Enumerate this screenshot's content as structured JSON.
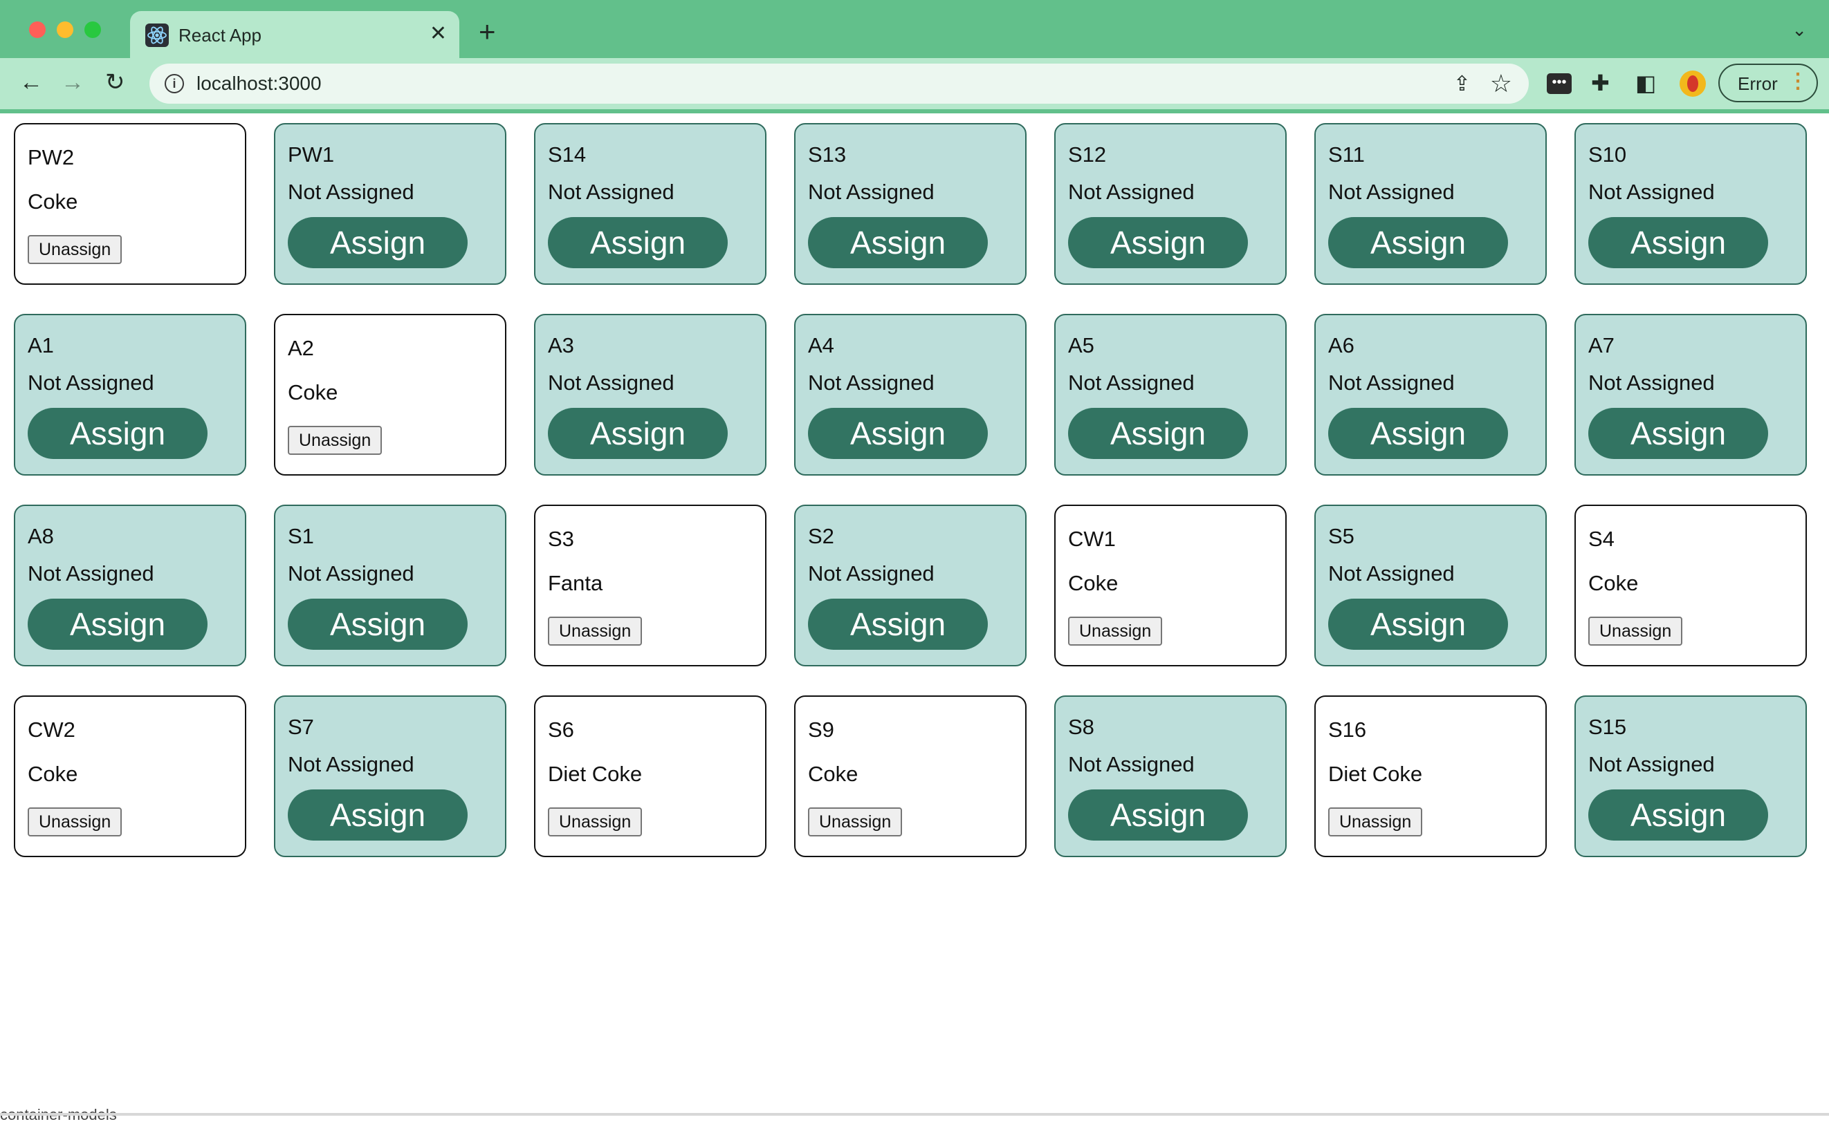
{
  "browser": {
    "tab_title": "React App",
    "url": "localhost:3000",
    "error_label": "Error",
    "icons": [
      "react-logo-icon",
      "close-icon",
      "plus-icon",
      "chevron-down-icon",
      "back-arrow-icon",
      "forward-arrow-icon",
      "reload-icon",
      "info-icon",
      "share-icon",
      "star-icon",
      "extension-icon",
      "puzzle-icon",
      "sidebar-icon",
      "profile-icon",
      "menu-dots-icon"
    ]
  },
  "labels": {
    "not_assigned": "Not Assigned",
    "assign": "Assign",
    "unassign": "Unassign"
  },
  "colors": {
    "chrome": "#62c08b",
    "card_unassigned_bg": "#bddfdb",
    "assign_button": "#327462"
  },
  "cards": [
    {
      "name": "PW2",
      "drink": "Coke"
    },
    {
      "name": "PW1",
      "drink": null
    },
    {
      "name": "S14",
      "drink": null
    },
    {
      "name": "S13",
      "drink": null
    },
    {
      "name": "S12",
      "drink": null
    },
    {
      "name": "S11",
      "drink": null
    },
    {
      "name": "S10",
      "drink": null
    },
    {
      "name": "A1",
      "drink": null
    },
    {
      "name": "A2",
      "drink": "Coke"
    },
    {
      "name": "A3",
      "drink": null
    },
    {
      "name": "A4",
      "drink": null
    },
    {
      "name": "A5",
      "drink": null
    },
    {
      "name": "A6",
      "drink": null
    },
    {
      "name": "A7",
      "drink": null
    },
    {
      "name": "A8",
      "drink": null
    },
    {
      "name": "S1",
      "drink": null
    },
    {
      "name": "S3",
      "drink": "Fanta"
    },
    {
      "name": "S2",
      "drink": null
    },
    {
      "name": "CW1",
      "drink": "Coke"
    },
    {
      "name": "S5",
      "drink": null
    },
    {
      "name": "S4",
      "drink": "Coke"
    },
    {
      "name": "CW2",
      "drink": "Coke"
    },
    {
      "name": "S7",
      "drink": null
    },
    {
      "name": "S6",
      "drink": "Diet Coke"
    },
    {
      "name": "S9",
      "drink": "Coke"
    },
    {
      "name": "S8",
      "drink": null
    },
    {
      "name": "S16",
      "drink": "Diet Coke"
    },
    {
      "name": "S15",
      "drink": null
    }
  ],
  "footer_text": "container-models"
}
